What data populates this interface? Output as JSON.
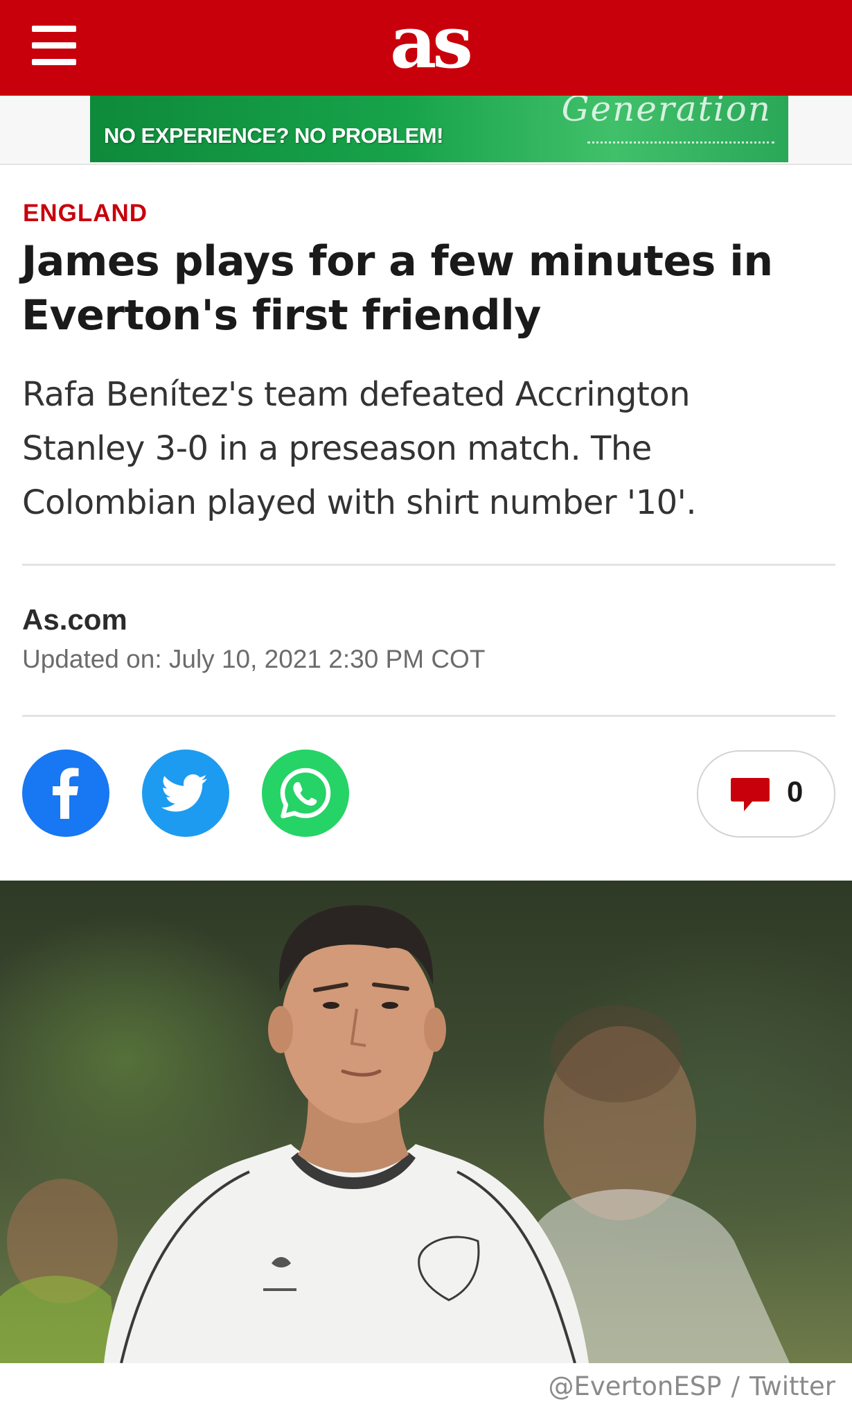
{
  "header": {
    "menu_icon": "hamburger-menu-icon",
    "logo_text": "as",
    "brand_color": "#c8000b"
  },
  "ad": {
    "tagline": "NO EXPERIENCE? NO PROBLEM!",
    "brand_text": "Generation"
  },
  "article": {
    "section": "ENGLAND",
    "headline": "James plays for a few minutes in Everton's first friendly",
    "subheadline": "Rafa Benítez's team defeated Accrington Stanley 3-0 in a preseason match. The Colombian played with shirt number '10'.",
    "author": "As.com",
    "updated": "Updated on: July 10, 2021 2:30 PM COT"
  },
  "share": {
    "facebook_icon": "facebook-icon",
    "twitter_icon": "twitter-icon",
    "whatsapp_icon": "whatsapp-icon",
    "comments_icon": "comment-bubble-icon",
    "comments_count": "0",
    "colors": {
      "facebook": "#1877f2",
      "twitter": "#1d9bf0",
      "whatsapp": "#25d366",
      "comments": "#c8000b"
    }
  },
  "photo": {
    "credit_source": "@EvertonESP",
    "separator": "/",
    "credit_platform": "Twitter"
  }
}
